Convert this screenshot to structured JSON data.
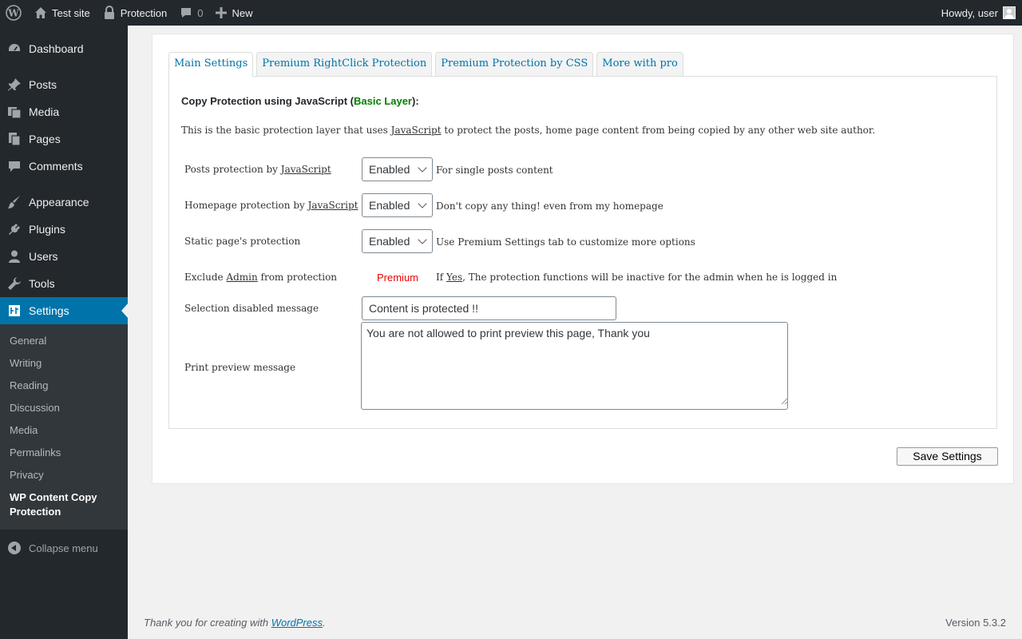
{
  "adminbar": {
    "site_name": "Test site",
    "protection": "Protection",
    "comments_count": "0",
    "new_label": "New",
    "howdy": "Howdy, user"
  },
  "sidebar": {
    "items": [
      {
        "label": "Dashboard",
        "icon": "dashboard-icon"
      },
      {
        "label": "Posts",
        "icon": "pin-icon"
      },
      {
        "label": "Media",
        "icon": "media-icon"
      },
      {
        "label": "Pages",
        "icon": "pages-icon"
      },
      {
        "label": "Comments",
        "icon": "comment-icon"
      },
      {
        "label": "Appearance",
        "icon": "brush-icon"
      },
      {
        "label": "Plugins",
        "icon": "plug-icon"
      },
      {
        "label": "Users",
        "icon": "user-icon"
      },
      {
        "label": "Tools",
        "icon": "wrench-icon"
      },
      {
        "label": "Settings",
        "icon": "settings-icon"
      }
    ],
    "submenu": [
      "General",
      "Writing",
      "Reading",
      "Discussion",
      "Media",
      "Permalinks",
      "Privacy",
      "WP Content Copy Protection"
    ],
    "collapse": "Collapse menu"
  },
  "tabs": [
    "Main Settings",
    "Premium RightClick Protection",
    "Premium Protection by CSS",
    "More with pro"
  ],
  "panel": {
    "heading_prefix": "Copy Protection using JavaScript (",
    "heading_green": "Basic Layer",
    "heading_suffix": "):",
    "intro_a": "This is the basic protection layer that uses ",
    "intro_link": "JavaScript",
    "intro_b": " to protect the posts, home page content from being copied by any other web site author.",
    "rows": [
      {
        "label_a": "Posts protection by ",
        "label_link": "JavaScript",
        "value": "Enabled",
        "desc": "For single posts content"
      },
      {
        "label_a": "Homepage protection by ",
        "label_link": "JavaScript",
        "value": "Enabled",
        "desc": "Don't copy any thing! even from my homepage"
      },
      {
        "label_a": "Static page's protection",
        "label_link": "",
        "value": "Enabled",
        "desc": "Use Premium Settings tab to customize more options"
      }
    ],
    "exclude_a": "Exclude ",
    "exclude_link": "Admin",
    "exclude_b": " from protection",
    "premium": "Premium",
    "exclude_desc_a": "If ",
    "exclude_desc_link": "Yes",
    "exclude_desc_b": ", The protection functions will be inactive for the admin when he is logged in",
    "selection_label": "Selection disabled message",
    "selection_value": "Content is protected !!",
    "print_label": "Print preview message",
    "print_value": "You are not allowed to print preview this page, Thank you"
  },
  "save_label": "Save Settings",
  "footer": {
    "thanks": "Thank you for creating with ",
    "wp_link": "WordPress",
    "period": ".",
    "version": "Version 5.3.2"
  }
}
